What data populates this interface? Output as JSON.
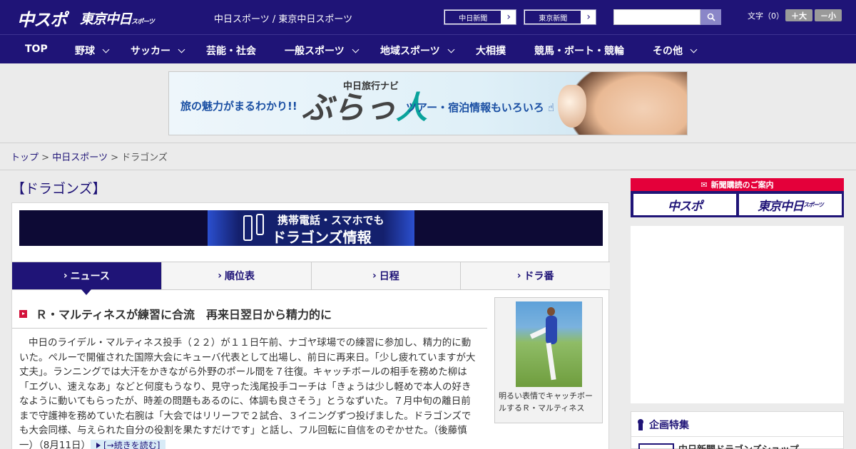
{
  "header": {
    "logo_chunichi_sports": "中スポ",
    "logo_tokyo_chunichi": "東京中日",
    "logo_tokyo_chunichi_suffix": "スポーツ",
    "site_links": "中日スポーツ / 東京中日スポーツ",
    "paper_links": [
      "中日新聞",
      "東京新聞"
    ],
    "search": {
      "placeholder": "",
      "value": ""
    },
    "font_size_label": "文字（0）",
    "font_larger": "＋大",
    "font_smaller": "－小"
  },
  "nav": {
    "items": [
      {
        "label": "TOP",
        "has_dropdown": false
      },
      {
        "label": "野球",
        "has_dropdown": true
      },
      {
        "label": "サッカー",
        "has_dropdown": true
      },
      {
        "label": "芸能・社会",
        "has_dropdown": false
      },
      {
        "label": "一般スポーツ",
        "has_dropdown": true
      },
      {
        "label": "地域スポーツ",
        "has_dropdown": true
      },
      {
        "label": "大相撲",
        "has_dropdown": false
      },
      {
        "label": "競馬・ボート・競輪",
        "has_dropdown": false
      },
      {
        "label": "その他",
        "has_dropdown": true
      }
    ]
  },
  "ad_banner": {
    "left_copy": "旅の魅力がまるわかり!!",
    "nav_label": "中日旅行ナビ",
    "brand_main": "ぶらっ",
    "brand_accent": "人",
    "right_copy": "ツアー・宿泊情報もいろいろ"
  },
  "breadcrumb": {
    "items": [
      "トップ",
      "中日スポーツ",
      "ドラゴンズ"
    ],
    "separator": ">"
  },
  "main": {
    "heading": "【ドラゴンズ】",
    "mobile_banner": {
      "line1": "携帯電話・スマホでも",
      "line2": "ドラゴンズ情報"
    },
    "tabs": [
      {
        "label": "ニュース",
        "active": true
      },
      {
        "label": "順位表",
        "active": false
      },
      {
        "label": "日程",
        "active": false
      },
      {
        "label": "ドラ番",
        "active": false
      }
    ],
    "article": {
      "title": "Ｒ・マルティネスが練習に合流　再来日翌日から精力的に",
      "body": "中日のライデル・マルティネス投手（２２）が１１日午前、ナゴヤ球場での練習に参加し、精力的に動いた。ペルーで開催された国際大会にキューバ代表として出場し、前日に再来日。「少し疲れていますが大丈夫」。ランニングでは大汗をかきながら外野のポール間を７往復。キャッチボールの相手を務めた柳は「エグい、速えなあ」などと何度もうなり、見守った浅尾投手コーチは「きょうは少し軽めで本人の好きなように動いてもらったが、時差の問題もあるのに、体調も良さそう」とうなずいた。７月中旬の離日前まで守護神を務めていた右腕は「大会ではリリーフで２試合、３イニングずつ投げました。ドラゴンズでも大会同様、与えられた自分の役割を果たすだけです」と話し、フル回転に自信をのぞかせた。（後藤慎一）（8月11日）",
      "read_more": "[→続きを読む]",
      "photo_caption": "明るい表情でキャッチボールするＲ・マルティネス"
    }
  },
  "sidebar": {
    "subscribe_title": "新聞購読のご案内",
    "subscribe_buttons": [
      "中スポ",
      "東京中日"
    ],
    "subscribe_button_suffix": "スポーツ",
    "feature_title": "企画特集",
    "feature_items": [
      "中日新聞ドラゴンズショップ"
    ]
  },
  "colors": {
    "brand_navy": "#1f1477",
    "accent_red": "#e4003a",
    "link_blue": "#1f1477",
    "read_more_bg": "#d8ebf7"
  }
}
